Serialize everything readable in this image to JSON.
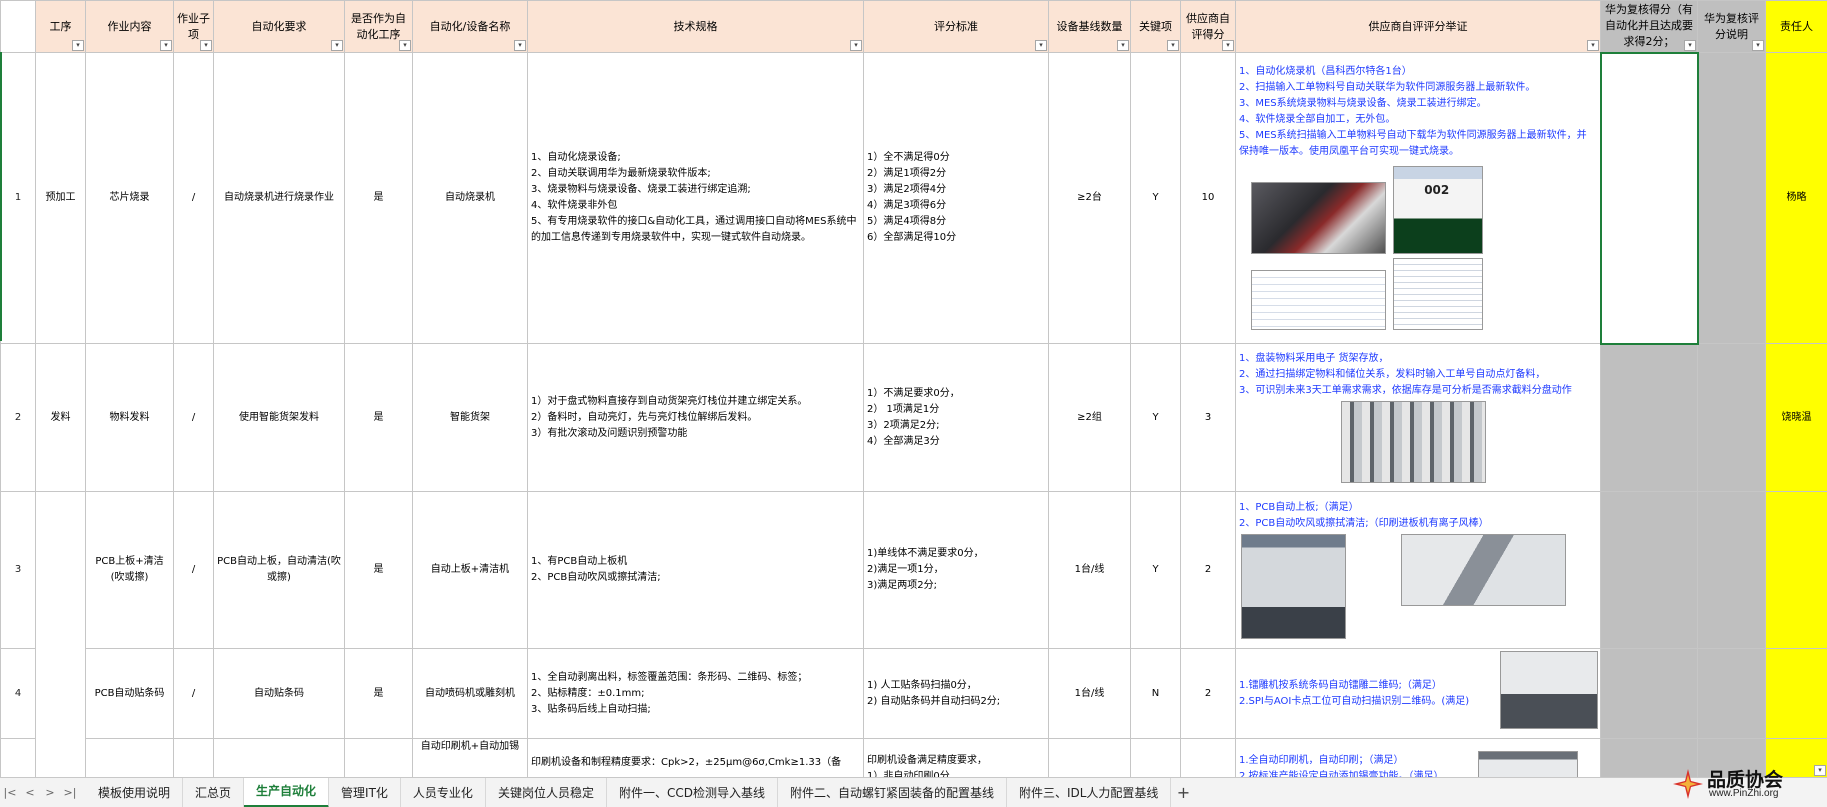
{
  "app": {
    "title": "生产自动化"
  },
  "header": {
    "col_process": "工序",
    "col_work": "作业内容",
    "col_sub": "作业子项",
    "col_auto_req": "自动化要求",
    "col_is_auto": "是否作为自动化工序",
    "col_equip": "自动化/设备名称",
    "col_spec": "技术规格",
    "col_score_std": "评分标准",
    "col_baseline": "设备基线数量",
    "col_key": "关键项",
    "col_supplier_score": "供应商自评得分",
    "col_evidence": "供应商自评评分举证",
    "col_hw_score": "华为复核得分（有自动化并且达成要求得2分；",
    "col_hw_note": "华为复核评分说明",
    "col_owner": "责任人"
  },
  "rows": [
    {
      "no": "1",
      "process": "预加工",
      "work": "芯片烧录",
      "sub": "/",
      "auto_req": "自动烧录机进行烧录作业",
      "is_auto": "是",
      "equip": "自动烧录机",
      "spec": [
        "1、自动化烧录设备;",
        "2、自动关联调用华为最新烧录软件版本;",
        "3、烧录物料与烧录设备、烧录工装进行绑定追溯;",
        "4、软件烧录非外包",
        "5、有专用烧录软件的接口&自动化工具，通过调用接口自动将MES系统中的加工信息传递到专用烧录软件中，实现一键式软件自动烧录。"
      ],
      "score_std": [
        "1）全不满足得0分",
        "2）满足1项得2分",
        "3）满足2项得4分",
        "4）满足3项得6分",
        "5）满足4项得8分",
        "6）全部满足得10分"
      ],
      "baseline": "≥2台",
      "key": "Y",
      "supplier_score": "10",
      "evidence": [
        "1、自动化烧录机（昌科西尔特各1台）",
        "2、扫描输入工单物料号自动关联华为软件同源服务器上最新软件。",
        "3、MES系统烧录物料与烧录设备、烧录工装进行绑定。",
        "4、软件烧录全部自加工，无外包。",
        "5、MES系统扫描输入工单物料号自动下载华为软件同源服务器上最新软件，并保持唯一版本。使用凤凰平台可实现一键式烧录。"
      ],
      "evidence_screen_label": "002",
      "owner": "杨略"
    },
    {
      "no": "2",
      "process": "发料",
      "work": "物料发料",
      "sub": "/",
      "auto_req": "使用智能货架发料",
      "is_auto": "是",
      "equip": "智能货架",
      "spec": [
        "1）对于盘式物料直接存到自动货架亮灯栈位并建立绑定关系。",
        "2）备料时，自动亮灯，先与亮灯栈位解绑后发料。",
        "3）有批次滚动及问题识别预警功能"
      ],
      "score_std": [
        "1）不满足要求0分，",
        "2）  1项满足1分",
        "3）2项满足2分;",
        "4）全部满足3分"
      ],
      "baseline": "≥2组",
      "key": "Y",
      "supplier_score": "3",
      "evidence": [
        "1、盘装物料采用电子 货架存放，",
        "2、通过扫描绑定物料和储位关系，发料时输入工单号自动点灯备料，",
        "3、可识别未来3天工单需求需求，依据库存是可分析是否需求截料分盘动作"
      ],
      "owner": "饶晓温"
    },
    {
      "no": "3",
      "process": "",
      "work": "PCB上板+清洁(吹或擦)",
      "sub": "/",
      "auto_req": "PCB自动上板，自动清洁(吹或擦)",
      "is_auto": "是",
      "equip": "自动上板+清洁机",
      "spec": [
        "1、有PCB自动上板机",
        "2、PCB自动吹风或擦拭清洁;"
      ],
      "score_std": [
        "1)单线体不满足要求0分，",
        "2)满足一项1分，",
        "3)满足两项2分;"
      ],
      "baseline": "1台/线",
      "key": "Y",
      "supplier_score": "2",
      "evidence": [
        "1、PCB自动上板;（满足）",
        "2、PCB自动吹风或擦拭清洁;（印刷进板机有离子风棒）"
      ],
      "owner": ""
    },
    {
      "no": "4",
      "process": "",
      "work": "PCB自动贴条码",
      "sub": "/",
      "auto_req": "自动贴条码",
      "is_auto": "是",
      "equip": "自动喷码机或雕刻机",
      "spec": [
        "1、全自动剥离出料，标签覆盖范围：条形码、二维码、标签；",
        "2、贴标精度：±0.1mm;",
        "3、贴条码后线上自动扫描;"
      ],
      "score_std": [
        "1) 人工贴条码扫描0分，",
        "2) 自动贴条码并自动扫码2分;"
      ],
      "baseline": "1台/线",
      "key": "N",
      "supplier_score": "2",
      "evidence": [
        "1.镭雕机按系统条码自动镭雕二维码;（满足）",
        "2.SPI与AOI卡点工位可自动扫描识别二维码。(满足)"
      ],
      "owner": ""
    },
    {
      "no": "",
      "process": "",
      "work": "",
      "sub": "",
      "auto_req": "",
      "is_auto": "",
      "equip": "自动印刷机+自动加锡",
      "spec": [
        "印刷机设备和制程精度要求：Cpk>2，±25μm@6σ,Cmk≥1.33（备"
      ],
      "score_std": [
        "印刷机设备满足精度要求，",
        "1）非自动印刷0分"
      ],
      "baseline": "",
      "key": "",
      "supplier_score": "",
      "evidence": [
        "1.全自动印刷机，自动印刷；（满足）",
        "2.按标准产能设定自动添加锡膏功能。（满足）"
      ],
      "owner": ""
    }
  ],
  "tabs": [
    {
      "label": "模板使用说明"
    },
    {
      "label": "汇总页"
    },
    {
      "label": "生产自动化"
    },
    {
      "label": "管理IT化"
    },
    {
      "label": "人员专业化"
    },
    {
      "label": "关键岗位人员稳定"
    },
    {
      "label": "附件一、CCD检测导入基线"
    },
    {
      "label": "附件二、自动螺钉紧固装备的配置基线"
    },
    {
      "label": "附件三、IDL人力配置基线"
    }
  ],
  "tab_nav": {
    "first": "|<",
    "prev": "<",
    "next": ">",
    "last": ">|",
    "add": "+"
  },
  "filter_glyph": "▾",
  "watermark": {
    "name": "品质协会",
    "url": "www.PinZhi.org"
  },
  "colors": {
    "header_bg": "#fbe4d5",
    "gray_col": "#bfbfbf",
    "yellow_col": "#ffff00",
    "evidence_text": "#1f3bff",
    "active_tab": "#1e7f3a"
  }
}
